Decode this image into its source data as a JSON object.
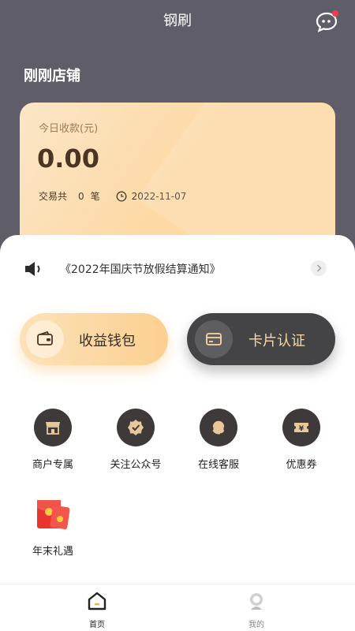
{
  "header": {
    "app_title": "钢刷",
    "shop_name": "刚刚店铺"
  },
  "card": {
    "label": "今日收款(元)",
    "amount": "0.00",
    "trade_prefix": "交易共",
    "trade_count": "0",
    "trade_unit": "笔",
    "date": "2022-11-07"
  },
  "notice": {
    "text": "《2022年国庆节放假结算通知》"
  },
  "actions": {
    "wallet_label": "收益钱包",
    "card_label": "卡片认证"
  },
  "grid": [
    {
      "label": "商户专属",
      "icon": "shop-icon"
    },
    {
      "label": "关注公众号",
      "icon": "verified-icon"
    },
    {
      "label": "在线客服",
      "icon": "headset-icon"
    },
    {
      "label": "优惠券",
      "icon": "coupon-icon"
    },
    {
      "label": "年末礼遇",
      "icon": "red-envelope-icon"
    }
  ],
  "tabbar": {
    "home_label": "首页",
    "mine_label": "我的"
  },
  "colors": {
    "header_bg": "#5f5d67",
    "accent_gold": "#fbd8a0",
    "dark_button": "#444446",
    "badge_red": "#f23d4f"
  }
}
